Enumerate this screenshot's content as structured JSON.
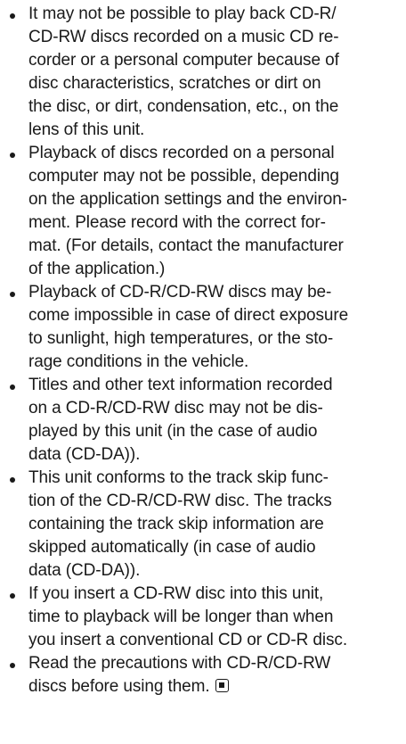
{
  "bullets": [
    {
      "lines": [
        "It may not be possible to play back CD-R/",
        "CD-RW discs recorded on a music CD re-",
        "corder or a personal computer because of",
        "disc characteristics, scratches or dirt on",
        "the disc, or dirt, condensation, etc., on the",
        "lens of this unit."
      ]
    },
    {
      "lines": [
        "Playback of discs recorded on a personal",
        "computer may not be possible, depending",
        "on the application settings and the environ-",
        "ment. Please record with the correct for-",
        "mat. (For details, contact the manufacturer",
        "of the application.)"
      ]
    },
    {
      "lines": [
        "Playback of CD-R/CD-RW discs may be-",
        "come impossible in case of direct exposure",
        "to sunlight, high temperatures, or the sto-",
        "rage conditions in the vehicle."
      ]
    },
    {
      "lines": [
        "Titles and other text information recorded",
        "on a CD-R/CD-RW disc may not be dis-",
        "played by this unit (in the case of audio",
        "data (CD-DA))."
      ]
    },
    {
      "lines": [
        "This unit conforms to the track skip func-",
        "tion of the CD-R/CD-RW disc. The tracks",
        "containing the track skip information are",
        "skipped automatically (in case of audio",
        "data (CD-DA))."
      ]
    },
    {
      "lines": [
        "If you insert a CD-RW disc into this unit,",
        "time to playback will be longer than when",
        "you insert a conventional CD or CD-R disc."
      ]
    },
    {
      "lines": [
        "Read the precautions with CD-R/CD-RW",
        "discs before using them."
      ],
      "end_mark_icon": "end-of-section-mark-icon"
    }
  ]
}
